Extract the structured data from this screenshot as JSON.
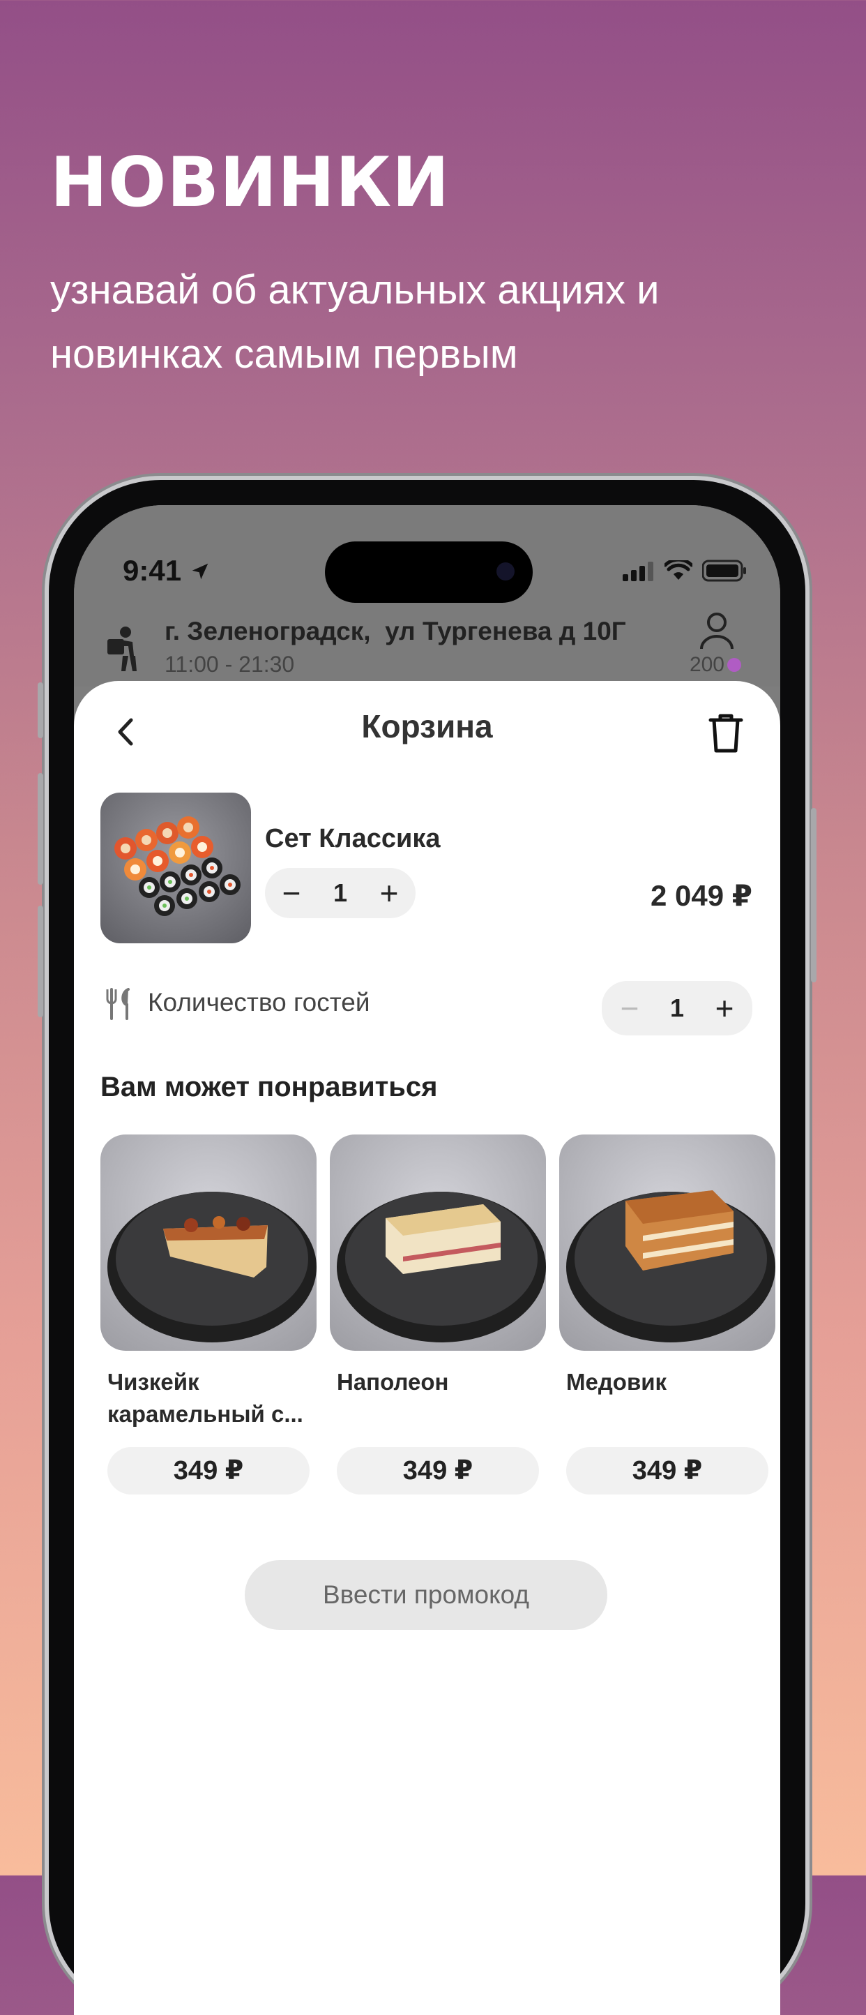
{
  "promo": {
    "title": "НОВИНКИ",
    "subtitle": "узнавай об актуальных акциях и новинках самым первым"
  },
  "status_bar": {
    "time": "9:41"
  },
  "header": {
    "address": "г. Зеленоградск,  ул Тургенева д 10Г",
    "hours": "11:00 - 21:30",
    "points": "200",
    "icons": [
      "delivery-person-icon",
      "profile-icon"
    ]
  },
  "cart": {
    "title": "Корзина",
    "item": {
      "name": "Сет Классика",
      "quantity": "1",
      "price": "2 049 ₽"
    },
    "guests": {
      "label": "Количество гостей",
      "quantity": "1"
    },
    "recommend_title": "Вам может понравиться",
    "recommendations": [
      {
        "name": "Чизкейк карамельный с...",
        "price": "349 ₽"
      },
      {
        "name": "Наполеон",
        "price": "349 ₽"
      },
      {
        "name": "Медовик",
        "price": "349 ₽"
      }
    ],
    "promo_button": "Ввести промокод"
  },
  "colors": {
    "accent_dot": "#b05cc4",
    "gradient_top": "#934f87",
    "gradient_bottom": "#f8bc9c"
  }
}
